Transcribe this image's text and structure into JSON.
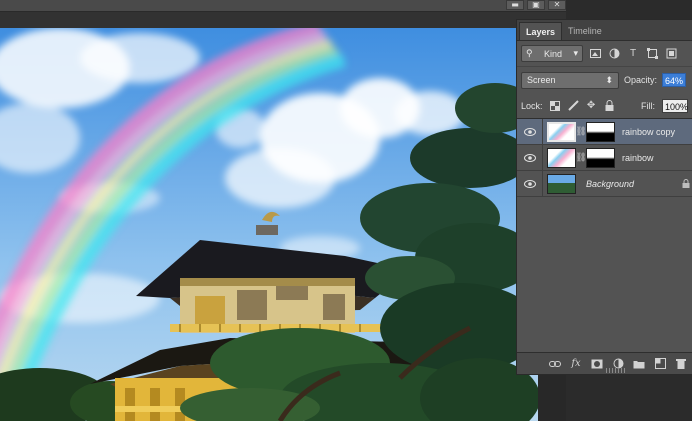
{
  "window": {
    "doc_controls": [
      "▬",
      "▣",
      "✕"
    ]
  },
  "layers_panel": {
    "tabs": [
      {
        "label": "Layers",
        "active": true
      },
      {
        "label": "Timeline",
        "active": false
      }
    ],
    "filter": {
      "kind_label": "Kind",
      "icons": [
        "image-filter-icon",
        "adjustment-filter-icon",
        "type-filter-icon",
        "shape-filter-icon",
        "smart-object-filter-icon"
      ]
    },
    "blend_mode": "Screen",
    "opacity_label": "Opacity:",
    "opacity_value": "64%",
    "lock_label": "Lock:",
    "fill_label": "Fill:",
    "fill_value": "100%",
    "layers": [
      {
        "name": "rainbow copy",
        "selected": true,
        "has_mask": true,
        "italic": false
      },
      {
        "name": "rainbow",
        "selected": false,
        "has_mask": true,
        "italic": false
      },
      {
        "name": "Background",
        "selected": false,
        "has_mask": false,
        "italic": true,
        "locked": true
      }
    ],
    "bottom_icons": [
      "link-layers-icon",
      "layer-style-fx-icon",
      "add-mask-icon",
      "adjustment-layer-icon",
      "new-group-icon",
      "new-layer-icon",
      "delete-layer-icon"
    ],
    "fx_label": "fx"
  },
  "colors": {
    "panel_bg": "#535353",
    "selection_bg": "#5e6a7d",
    "opacity_highlight": "#3b7ed8"
  }
}
